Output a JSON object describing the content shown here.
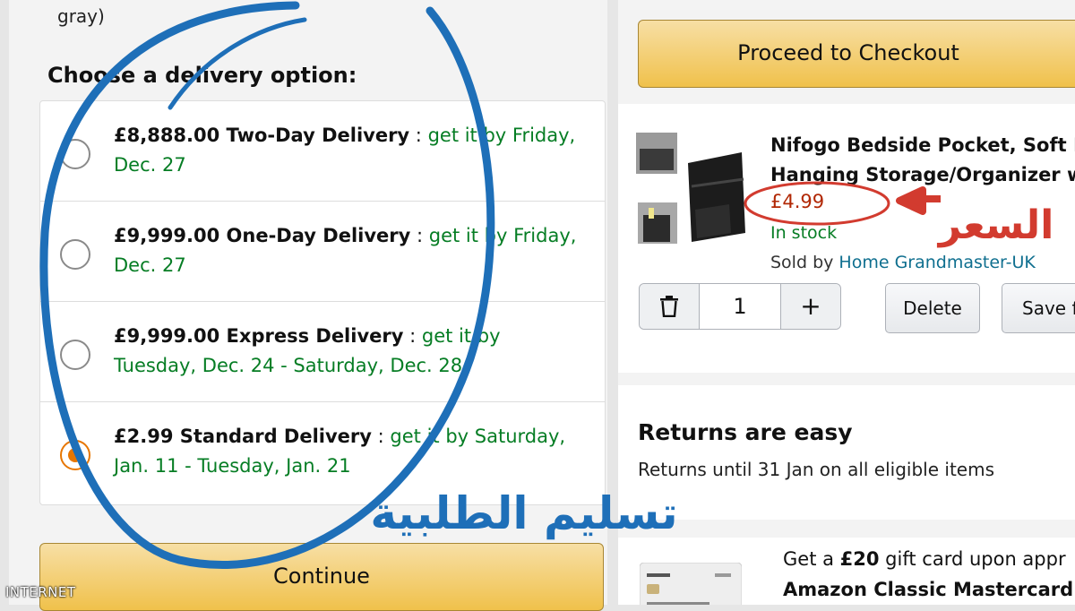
{
  "left": {
    "prev_text": "gray)",
    "heading": "Choose a delivery option:",
    "options": [
      {
        "name": "£8,888.00 Two-Day Delivery",
        "sep": " : ",
        "date": "get it by Friday, Dec. 27",
        "selected": false
      },
      {
        "name": "£9,999.00 One-Day Delivery",
        "sep": " : ",
        "date": "get it by Friday, Dec. 27",
        "selected": false
      },
      {
        "name": "£9,999.00 Express Delivery",
        "sep": " : ",
        "date": "get it by Tuesday, Dec. 24 - Saturday, Dec. 28",
        "selected": false
      },
      {
        "name": "£2.99 Standard Delivery",
        "sep": " : ",
        "date": "get it by Saturday, Jan. 11 - Tuesday, Jan. 21",
        "selected": true
      }
    ],
    "continue_label": "Continue"
  },
  "right": {
    "checkout_label": "Proceed to Checkout",
    "product": {
      "title_line1": "Nifogo Bedside Pocket, Soft F",
      "title_line2": "Hanging Storage/Organizer w",
      "price": "£4.99",
      "stock": "In stock",
      "sold_by_prefix": "Sold by ",
      "seller": "Home Grandmaster-UK",
      "quantity": "1",
      "plus": "+",
      "delete_label": "Delete",
      "save_label": "Save f"
    },
    "returns": {
      "title": "Returns are easy",
      "text": "Returns until 31 Jan on all eligible items"
    },
    "offer": {
      "line1_prefix": "Get a ",
      "line1_bold": "£20",
      "line1_suffix": " gift card upon appr",
      "line2": "Amazon Classic Mastercard."
    }
  },
  "annotations": {
    "price_note": "السعر",
    "delivery_note": "تسليم الطلبية",
    "circle_color": "#1e6fb8",
    "price_circle_color": "#d23b2f"
  },
  "watermark": "INTERNET",
  "colors": {
    "button_yellow": "#f0c14b",
    "price_red": "#b12704",
    "stock_green": "#067d24",
    "radio_orange": "#e77600"
  }
}
